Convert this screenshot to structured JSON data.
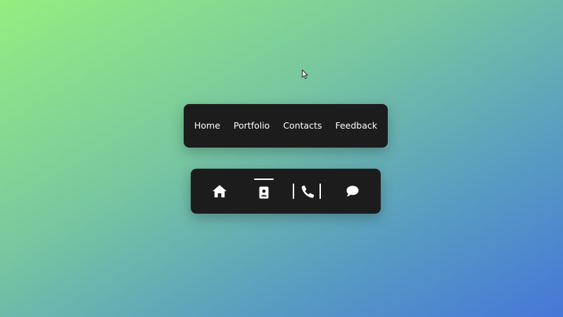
{
  "text_nav": {
    "items": [
      {
        "label": "Home"
      },
      {
        "label": "Portfolio"
      },
      {
        "label": "Contacts"
      },
      {
        "label": "Feedback"
      }
    ]
  },
  "icon_nav": {
    "items": [
      {
        "icon": "home-icon"
      },
      {
        "icon": "contact-card-icon",
        "state": "active"
      },
      {
        "icon": "phone-icon",
        "state": "hover"
      },
      {
        "icon": "chat-bubble-icon"
      }
    ]
  },
  "colors": {
    "panel": "#1c1c1c",
    "text": "#ffffff",
    "gradient_start": "#94ee80",
    "gradient_end": "#4577d8"
  }
}
